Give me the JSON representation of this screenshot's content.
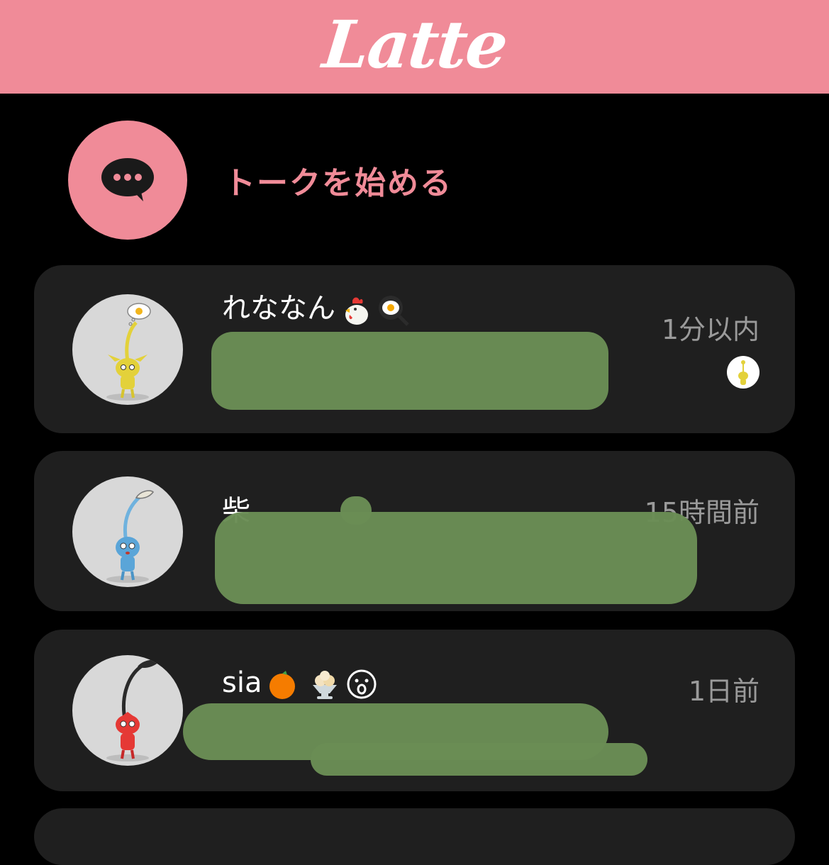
{
  "header": {
    "app_title": "Latte",
    "brand_color": "#f08b98"
  },
  "start_talk": {
    "label": "トークを始める",
    "icon": "chat-bubble-icon"
  },
  "conversations": [
    {
      "name": "れななん",
      "emojis": [
        "rooster-emoji",
        "fried-egg-emoji"
      ],
      "time": "1分以内",
      "avatar": "yellow-pikmin-avatar",
      "read_indicator": "yellow-pikmin-avatar"
    },
    {
      "name": "柴",
      "emojis": [],
      "time": "15時間前",
      "avatar": "blue-pikmin-avatar"
    },
    {
      "name": "sia",
      "emojis": [
        "orange-emoji",
        "ice-cream-emoji",
        "surprised-face-emoji"
      ],
      "time": "1日前",
      "avatar": "red-pikmin-avatar"
    }
  ],
  "colors": {
    "background": "#000000",
    "card": "#1f1f1f",
    "redaction": "#6a8d55",
    "time_text": "#9a9a9a"
  }
}
